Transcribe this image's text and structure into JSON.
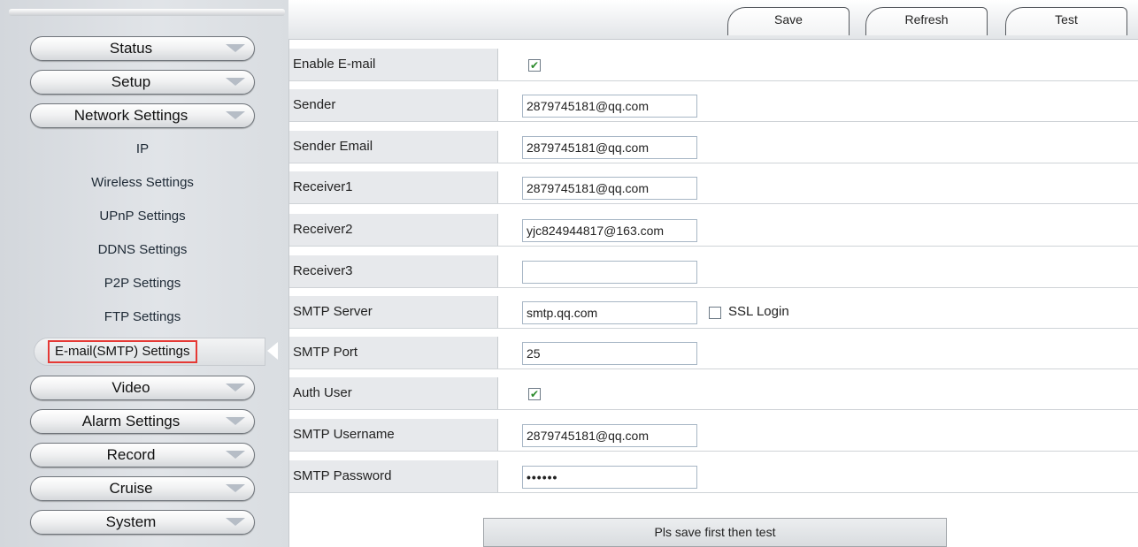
{
  "toolbar": {
    "save_label": "Save",
    "refresh_label": "Refresh",
    "test_label": "Test"
  },
  "sidebar": {
    "menus_top": [
      {
        "label": "Status"
      },
      {
        "label": "Setup"
      },
      {
        "label": "Network Settings"
      }
    ],
    "submenu": [
      {
        "label": "IP"
      },
      {
        "label": "Wireless Settings"
      },
      {
        "label": "UPnP Settings"
      },
      {
        "label": "DDNS Settings"
      },
      {
        "label": "P2P Settings"
      },
      {
        "label": "FTP Settings"
      }
    ],
    "active_label": "E-mail(SMTP) Settings",
    "menus_bottom": [
      {
        "label": "Video"
      },
      {
        "label": "Alarm Settings"
      },
      {
        "label": "Record"
      },
      {
        "label": "Cruise"
      },
      {
        "label": "System"
      }
    ]
  },
  "form": {
    "enable_email": {
      "label": "Enable E-mail",
      "checked": true
    },
    "sender": {
      "label": "Sender",
      "value": "2879745181@qq.com"
    },
    "sender_email": {
      "label": "Sender Email",
      "value": "2879745181@qq.com"
    },
    "receiver1": {
      "label": "Receiver1",
      "value": "2879745181@qq.com"
    },
    "receiver2": {
      "label": "Receiver2",
      "value": "yjc824944817@163.com"
    },
    "receiver3": {
      "label": "Receiver3",
      "value": ""
    },
    "smtp_server": {
      "label": "SMTP Server",
      "value": "smtp.qq.com"
    },
    "ssl_login": {
      "label": "SSL Login",
      "checked": false
    },
    "smtp_port": {
      "label": "SMTP Port",
      "value": "25"
    },
    "auth_user": {
      "label": "Auth User",
      "checked": true
    },
    "smtp_username": {
      "label": "SMTP Username",
      "value": "2879745181@qq.com"
    },
    "smtp_password": {
      "label": "SMTP Password",
      "value": "••••••"
    }
  },
  "test_note": "Pls save first then test"
}
